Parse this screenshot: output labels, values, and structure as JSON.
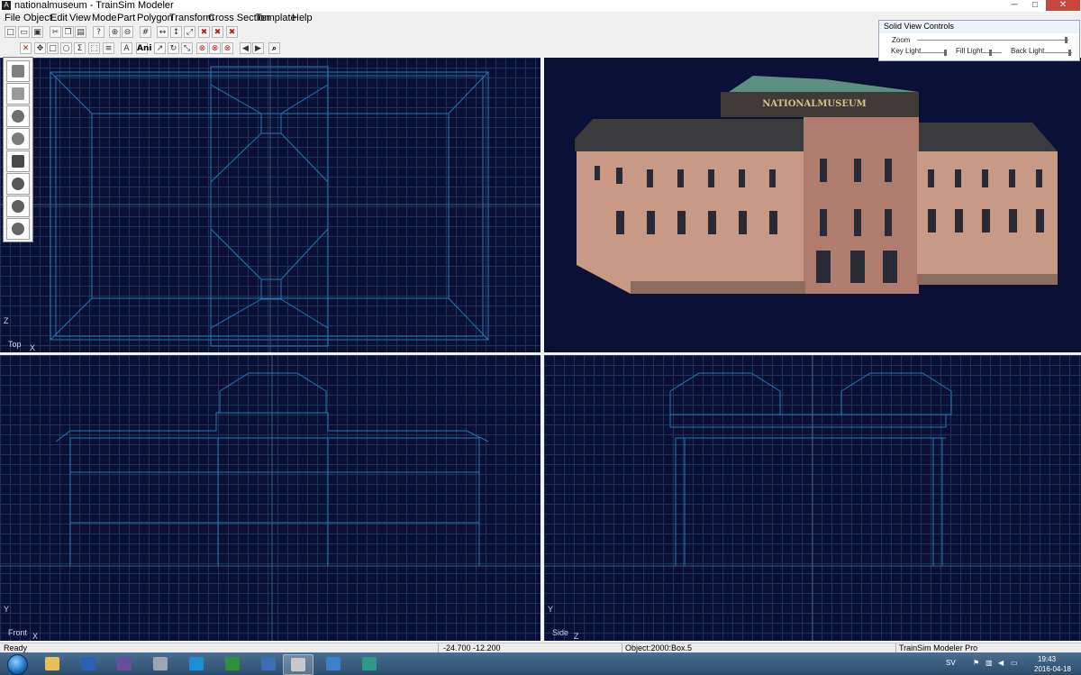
{
  "window": {
    "title": "nationalmuseum - TrainSim Modeler",
    "minimize": "─",
    "maximize": "□",
    "close": "✕"
  },
  "menu": [
    "File",
    "Object",
    "Edit",
    "View",
    "Mode",
    "Part",
    "Polygon",
    "Transform",
    "Cross Section",
    "Template",
    "Help"
  ],
  "toolbar1": [
    {
      "name": "new-icon",
      "glyph": "□"
    },
    {
      "name": "open-icon",
      "glyph": "▭"
    },
    {
      "name": "save-icon",
      "glyph": "▣"
    },
    {
      "name": "cut-icon",
      "glyph": "✂"
    },
    {
      "name": "copy-icon",
      "glyph": "❐"
    },
    {
      "name": "paste-icon",
      "glyph": "▤"
    },
    {
      "name": "help-icon",
      "glyph": "?"
    },
    {
      "name": "zoom-in-icon",
      "glyph": "⊕"
    },
    {
      "name": "zoom-out-icon",
      "glyph": "⊖"
    },
    {
      "name": "grid-icon",
      "glyph": "#"
    },
    {
      "name": "align-x-icon",
      "glyph": "↔"
    },
    {
      "name": "align-y-icon",
      "glyph": "↕"
    },
    {
      "name": "align-z-icon",
      "glyph": "⤢"
    },
    {
      "name": "delete-red-icon",
      "glyph": "✖"
    },
    {
      "name": "delete-vertex-icon",
      "glyph": "✖"
    },
    {
      "name": "delete-part-icon",
      "glyph": "✖"
    }
  ],
  "toolbar2": [
    {
      "name": "close-panel-icon",
      "glyph": "✕"
    },
    {
      "name": "move-icon",
      "glyph": "✥"
    },
    {
      "name": "rect-select-icon",
      "glyph": "□"
    },
    {
      "name": "circle-icon",
      "glyph": "○"
    },
    {
      "name": "sigma-icon",
      "glyph": "Σ"
    },
    {
      "name": "select-dotted-icon",
      "glyph": "⬚"
    },
    {
      "name": "equal-icon",
      "glyph": "≡"
    },
    {
      "name": "text-icon",
      "glyph": "A"
    },
    {
      "name": "ani-icon",
      "glyph": "Ani"
    },
    {
      "name": "arrow-icon",
      "glyph": "↗"
    },
    {
      "name": "rotate-icon",
      "glyph": "↻"
    },
    {
      "name": "scale-icon",
      "glyph": "⤡"
    },
    {
      "name": "stop-red-icon",
      "glyph": "⊗"
    },
    {
      "name": "stop-vertex-icon",
      "glyph": "⊗"
    },
    {
      "name": "stop-part-icon",
      "glyph": "⊗"
    },
    {
      "name": "prev-icon",
      "glyph": "◀"
    },
    {
      "name": "next-icon",
      "glyph": "▶"
    },
    {
      "name": "binoculars-icon",
      "glyph": "⌕"
    }
  ],
  "viewports": {
    "top": {
      "label": "Top",
      "axis_h": "X",
      "axis_v": "Z"
    },
    "front": {
      "label": "Front",
      "axis_h": "X",
      "axis_v": "Y"
    },
    "side": {
      "label": "Side",
      "axis_h": "Z",
      "axis_v": "Y"
    },
    "solid": {
      "sign_text": "NATIONALMUSEUM"
    }
  },
  "solid_view_controls": {
    "title": "Solid View Controls",
    "zoom": "Zoom",
    "key_light": "Key Light",
    "fill_light": "Fill Light",
    "back_light": "Back Light"
  },
  "toolbox": [
    "cube-icon",
    "cylinder-icon",
    "sphere-icon",
    "capsule-icon",
    "cone-icon",
    "globe-icon",
    "geosphere-icon",
    "hemisphere-icon"
  ],
  "status": {
    "ready": "Ready",
    "coords": "-24.700  -12.200",
    "object": "Object:2000:Box.5",
    "app": "TrainSim Modeler Pro"
  },
  "taskbar": {
    "apps": [
      "explorer-icon",
      "word-icon",
      "save-app-icon",
      "calculator-icon",
      "ie-icon",
      "excel-icon",
      "outlook-icon",
      "trainsim-icon",
      "chrome-icon",
      "sketch-icon"
    ],
    "lang": "SV",
    "time": "19:43",
    "date": "2016-04-18"
  },
  "colors": {
    "viewport_bg": "#0b1136",
    "grid": "#1f3558",
    "wire": "#1f78b4",
    "building": "#c89a86",
    "roof": "#3b3a3c",
    "dome": "#5c8e82"
  }
}
